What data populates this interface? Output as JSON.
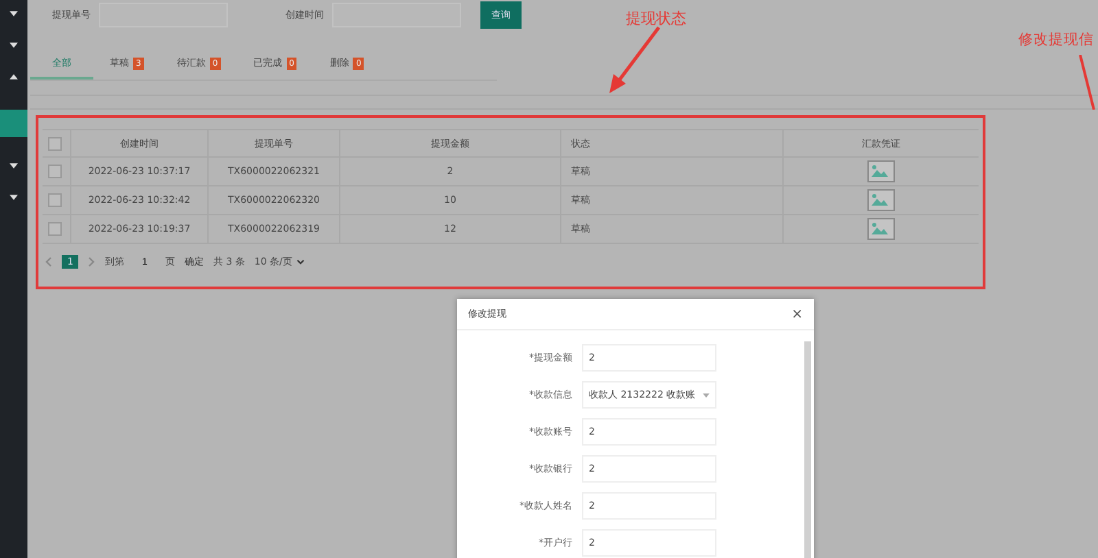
{
  "search": {
    "fields": [
      {
        "label": "提现单号"
      },
      {
        "label": "创建时间"
      }
    ],
    "button": "查询"
  },
  "tabs": [
    {
      "label": "全部",
      "selected": true
    },
    {
      "label": "草稿",
      "selected": false,
      "badge": "3"
    },
    {
      "label": "待汇款",
      "selected": false,
      "badge": "0"
    },
    {
      "label": "已完成",
      "selected": false,
      "badge": "0"
    },
    {
      "label": "删除",
      "selected": false,
      "badge": "0"
    }
  ],
  "table": {
    "header_checked": false,
    "columns": [
      "创建时间",
      "提现单号",
      "提现金额",
      "状态",
      "汇款凭证"
    ],
    "rows": [
      {
        "checked": false,
        "cells": [
          "2022-06-23 10:37:17",
          "TX6000022062321",
          "2",
          "草稿"
        ]
      },
      {
        "checked": false,
        "cells": [
          "2022-06-23 10:32:42",
          "TX6000022062320",
          "10",
          "草稿"
        ]
      },
      {
        "checked": false,
        "cells": [
          "2022-06-23 10:19:37",
          "TX6000022062319",
          "12",
          "草稿"
        ]
      }
    ]
  },
  "pagination": {
    "pages": [
      {
        "label": "1",
        "selected": true
      }
    ],
    "goto_label": "到第",
    "goto_value": "1",
    "page_unit": "页",
    "confirm": "确定",
    "total": "共 3 条",
    "page_size": "10 条/页"
  },
  "annotations": [
    {
      "text": "提现状态"
    },
    {
      "text": "修改提现信"
    }
  ],
  "dialog": {
    "title": "修改提现",
    "close": "×",
    "fields": [
      {
        "label": "*提现金额",
        "value": "2",
        "kind": "input"
      },
      {
        "label": "*收款信息",
        "value": "收款人 2132222 收款账",
        "kind": "select"
      },
      {
        "label": "*收款账号",
        "value": "2",
        "kind": "input"
      },
      {
        "label": "*收款银行",
        "value": "2",
        "kind": "input"
      },
      {
        "label": "*收款人姓名",
        "value": "2",
        "kind": "input"
      },
      {
        "label": "*开户行",
        "value": "2",
        "kind": "input"
      }
    ]
  }
}
